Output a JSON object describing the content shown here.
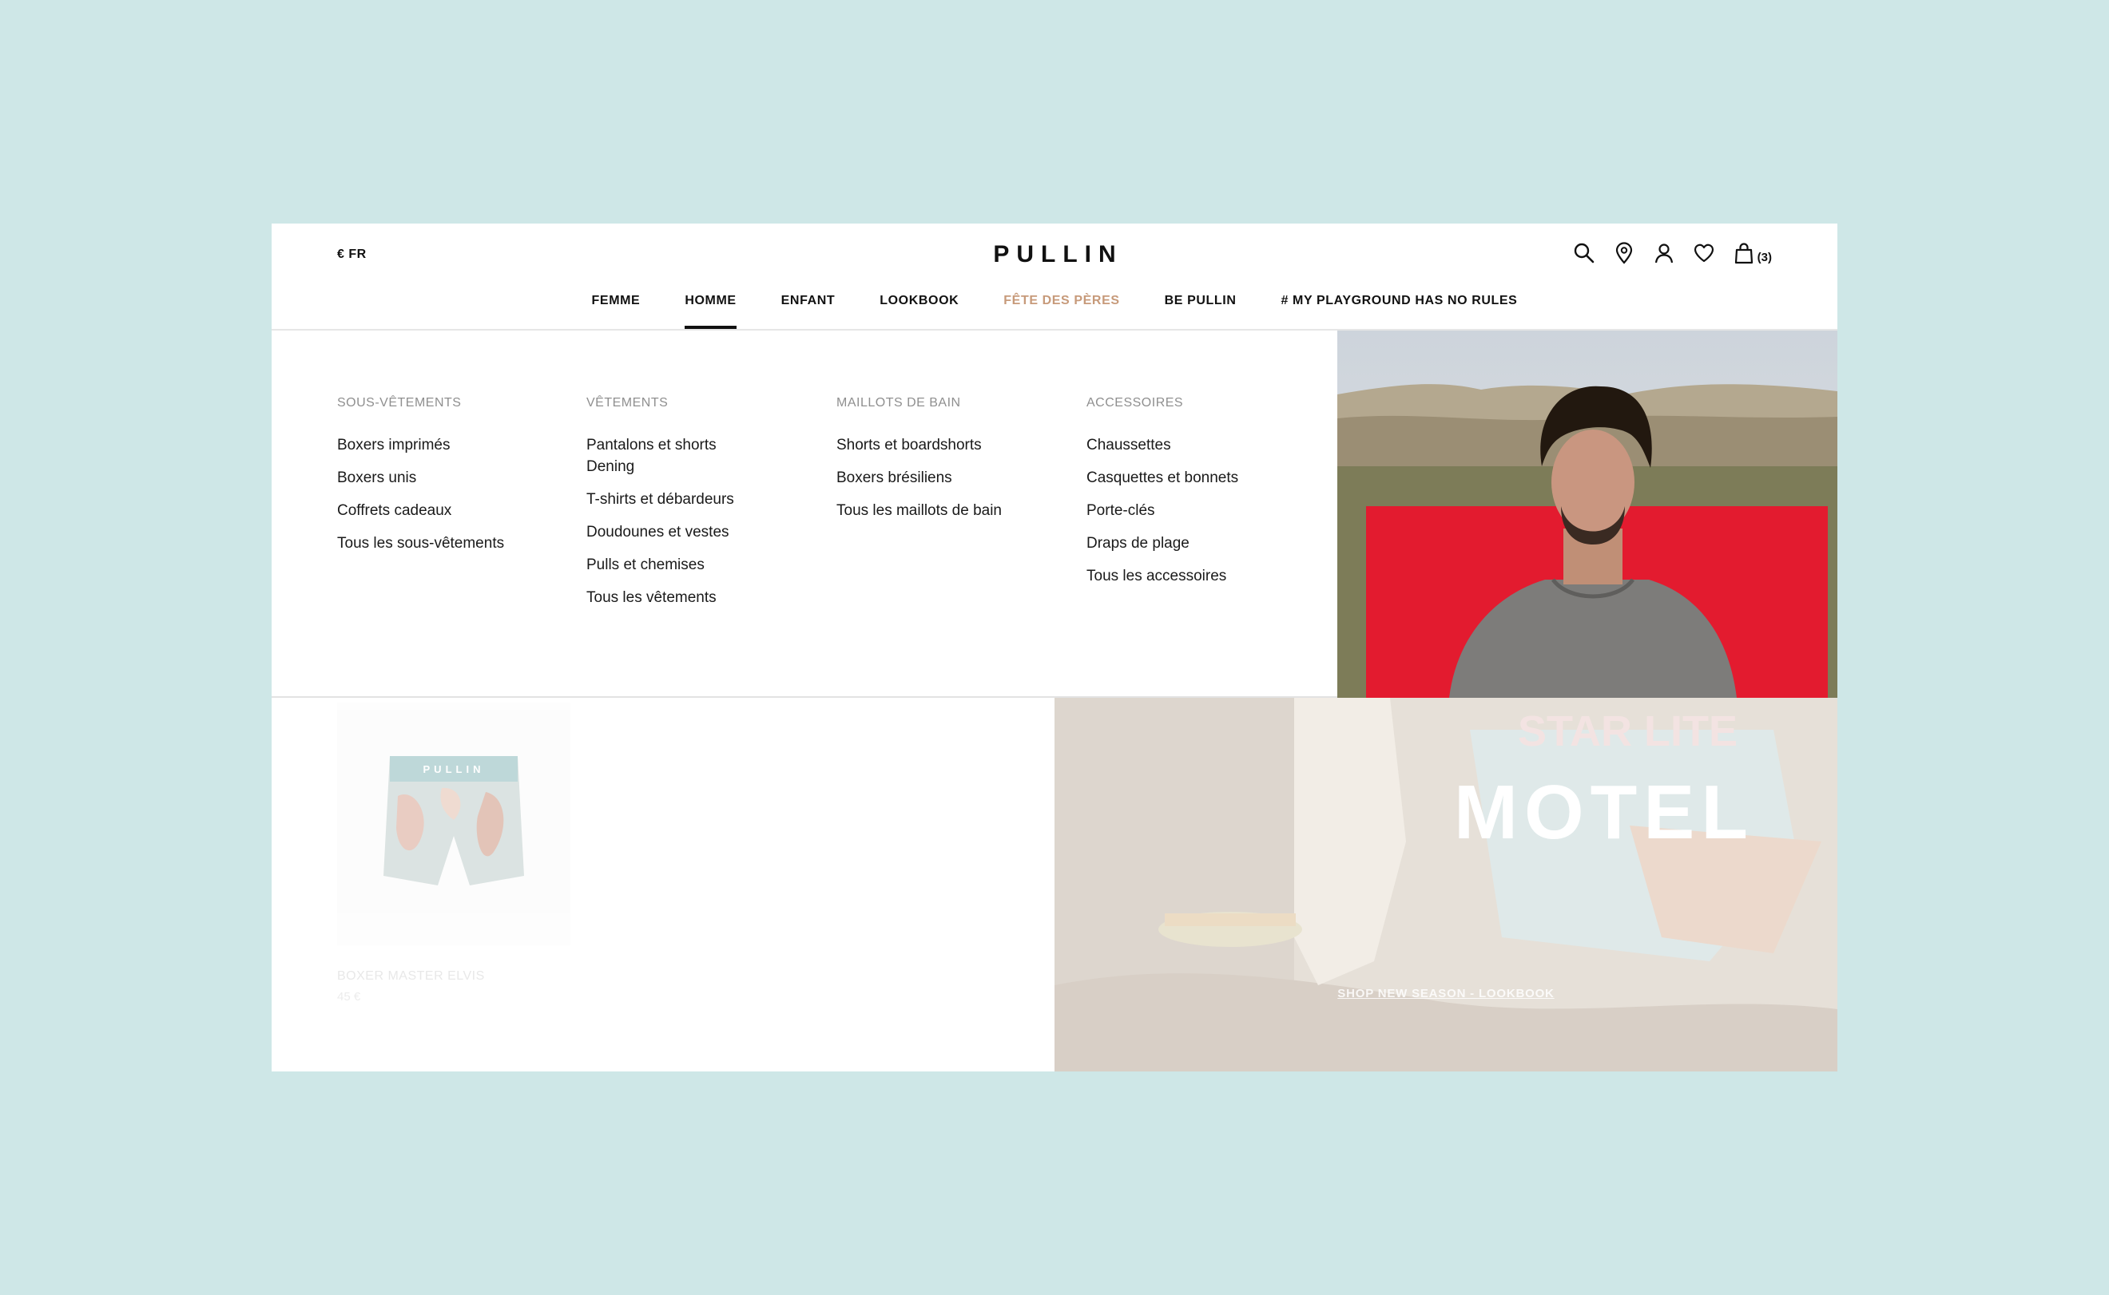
{
  "header": {
    "locale": "€ FR",
    "logo": "PULLIN",
    "cart_count": "(3)",
    "icons": [
      "search-icon",
      "store-locator-icon",
      "account-icon",
      "wishlist-icon",
      "cart-icon"
    ]
  },
  "nav": {
    "items": [
      {
        "label": "FEMME"
      },
      {
        "label": "HOMME",
        "active": true
      },
      {
        "label": "ENFANT"
      },
      {
        "label": "LOOKBOOK"
      },
      {
        "label": "FÊTE DES PÈRES",
        "highlight": true
      },
      {
        "label": "BE PULLIN"
      },
      {
        "label": "# MY PLAYGROUND HAS NO RULES"
      }
    ]
  },
  "mega_menu": {
    "columns": [
      {
        "title": "SOUS-VÊTEMENTS",
        "links": [
          "Boxers imprimés",
          "Boxers unis",
          "Coffrets cadeaux",
          "Tous les sous-vêtements"
        ]
      },
      {
        "title": "VÊTEMENTS",
        "links": [
          "Pantalons et shorts Dening",
          "T-shirts et débardeurs",
          "Doudounes et vestes",
          "Pulls et chemises",
          "Tous les vêtements"
        ]
      },
      {
        "title": "MAILLOTS DE BAIN",
        "links": [
          "Shorts et boardshorts",
          "Boxers brésiliens",
          "Tous les maillots de bain"
        ]
      },
      {
        "title": "ACCESSOIRES",
        "links": [
          "Chaussettes",
          "Casquettes et bonnets",
          "Porte-clés",
          "Draps de plage",
          "Tous les accessoires"
        ]
      }
    ]
  },
  "product": {
    "name": "BOXER MASTER ELVIS",
    "price": "45 €",
    "waistband_text": "PULLIN"
  },
  "lookbook": {
    "link": "SHOP NEW SEASON - LOOKBOOK",
    "sign_line1": "STAR LITE",
    "sign_line2": "MOTEL"
  },
  "colors": {
    "background": "#cee7e7",
    "accent_highlight": "#c79a7a",
    "hero_red": "#e31b2f"
  }
}
